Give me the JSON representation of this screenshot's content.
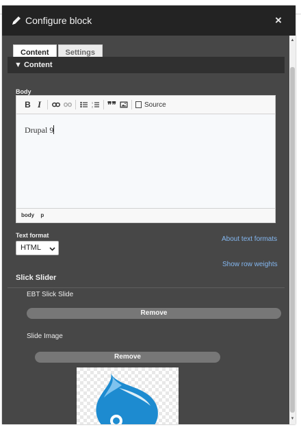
{
  "dialog": {
    "title": "Configure block",
    "close_label": "×"
  },
  "tabs": [
    {
      "label": "Content",
      "active": true
    },
    {
      "label": "Settings",
      "active": false
    }
  ],
  "section": {
    "label": "▼ Content"
  },
  "body_field": {
    "label": "Body",
    "toolbar": {
      "bold_label": "B",
      "italic_label": "I",
      "blockquote_label": "❞❞",
      "source_label": "Source"
    },
    "content": "Drupal 9",
    "path": [
      "body",
      "p"
    ]
  },
  "text_format": {
    "label": "Text format",
    "selected": "HTML",
    "about_link": "About text formats"
  },
  "show_row_weights": "Show row weights",
  "slick": {
    "title": "Slick Slider",
    "slide_label": "EBT Slick Slide",
    "remove_label": "Remove",
    "slide_image_label": "Slide Image",
    "image_remove_label": "Remove"
  },
  "colors": {
    "panel_bg": "#474747",
    "header_bg": "#232323",
    "section_bg": "#303030",
    "link": "#84b7f0",
    "button_bg": "#777777",
    "drupal_blue": "#1d8bd0"
  }
}
